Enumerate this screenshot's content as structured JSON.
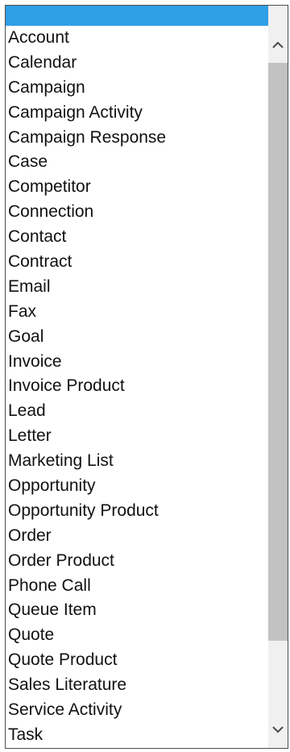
{
  "dropdown": {
    "selected_label": "",
    "options": [
      "Account",
      "Calendar",
      "Campaign",
      "Campaign Activity",
      "Campaign Response",
      "Case",
      "Competitor",
      "Connection",
      "Contact",
      "Contract",
      "Email",
      "Fax",
      "Goal",
      "Invoice",
      "Invoice Product",
      "Lead",
      "Letter",
      "Marketing List",
      "Opportunity",
      "Opportunity Product",
      "Order",
      "Order Product",
      "Phone Call",
      "Queue Item",
      "Quote",
      "Quote Product",
      "Sales Literature",
      "Service Activity",
      "Task"
    ],
    "highlight_color": "#2f9fe6"
  },
  "scrollbar": {
    "up_icon": "chevron-up-icon",
    "down_icon": "chevron-down-icon"
  }
}
